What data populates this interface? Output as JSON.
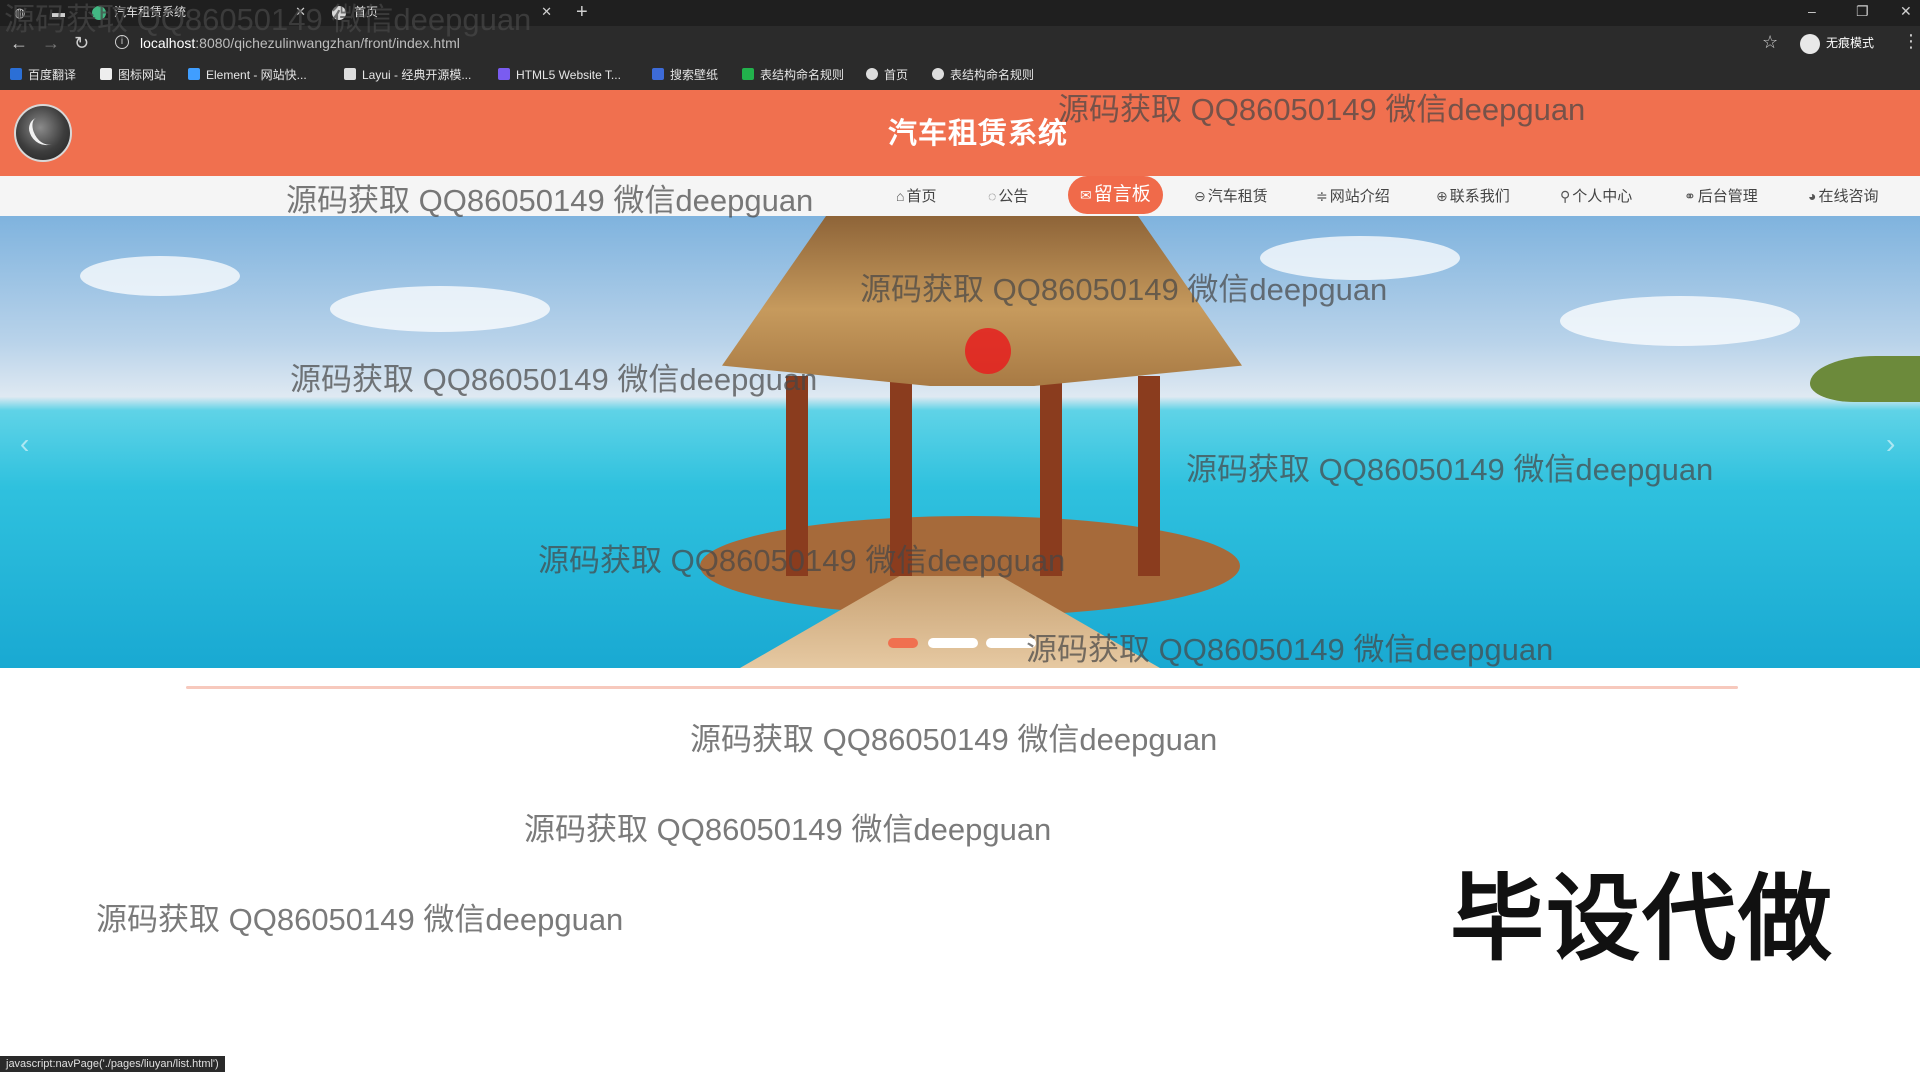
{
  "browser": {
    "tabs": [
      {
        "title": "汽车租赁系统",
        "icon": "vue-icon"
      },
      {
        "title": "首页",
        "icon": "globe-icon"
      }
    ],
    "url_host": "localhost",
    "url_path": ":8080/qichezulinwangzhan/front/index.html",
    "profile_label": "无痕模式",
    "bookmarks": [
      {
        "label": "百度翻译",
        "color": "#2b6fd6"
      },
      {
        "label": "图标网站",
        "color": "#eeeeee"
      },
      {
        "label": "Element - 网站快...",
        "color": "#409eff"
      },
      {
        "label": "Layui - 经典开源模...",
        "color": "#dddddd"
      },
      {
        "label": "HTML5 Website T...",
        "color": "#7a5cf0"
      },
      {
        "label": "搜索壁纸",
        "color": "#3d6bd8"
      },
      {
        "label": "表结构命名规则",
        "color": "#22b14c"
      },
      {
        "label": "首页",
        "color": "#dddddd"
      },
      {
        "label": "表结构命名规则",
        "color": "#dddddd"
      }
    ]
  },
  "site": {
    "title": "汽车租赁系统",
    "nav": [
      {
        "label": "首页",
        "icon": "home-icon",
        "glyph": "⌂"
      },
      {
        "label": "公告",
        "icon": "bell-icon",
        "glyph": "◌"
      },
      {
        "label": "留言板",
        "icon": "message-icon",
        "glyph": "✉",
        "active": true
      },
      {
        "label": "汽车租赁",
        "icon": "car-icon",
        "glyph": "⊖"
      },
      {
        "label": "网站介绍",
        "icon": "sliders-icon",
        "glyph": "≑"
      },
      {
        "label": "联系我们",
        "icon": "globe-icon",
        "glyph": "⊕"
      },
      {
        "label": "个人中心",
        "icon": "user-icon",
        "glyph": "⚲"
      },
      {
        "label": "后台管理",
        "icon": "link-icon",
        "glyph": "⚭"
      },
      {
        "label": "在线咨询",
        "icon": "chat-icon",
        "glyph": "◕"
      }
    ],
    "accent": "#f0704f",
    "carousel": {
      "slides": 3,
      "active": 1
    }
  },
  "overlay": {
    "watermark": "源码获取 QQ86050149 微信deepguan",
    "promo": "毕设代做"
  },
  "status_url": "javascript:navPage('./pages/liuyan/list.html')"
}
